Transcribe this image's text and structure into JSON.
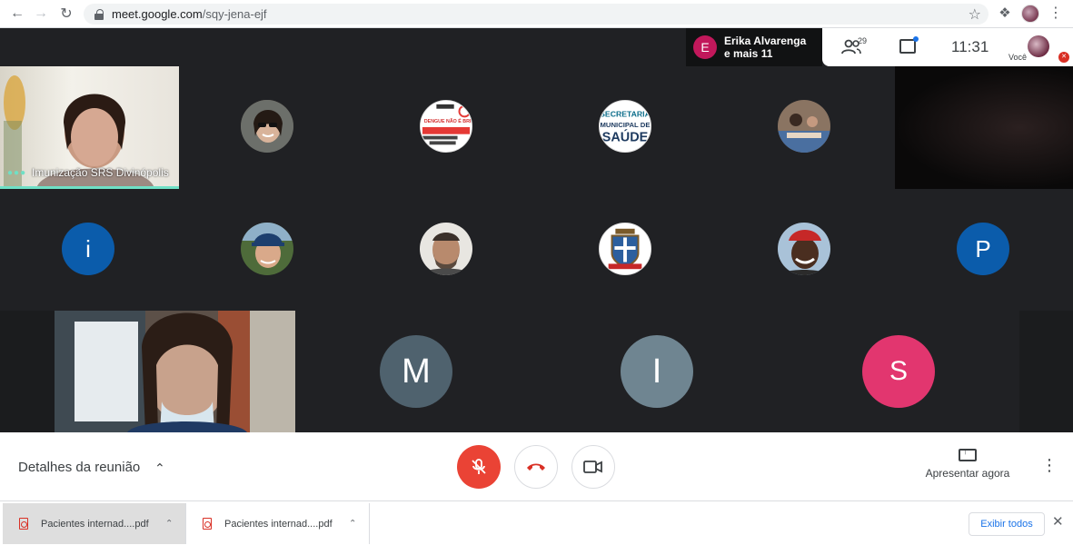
{
  "browser": {
    "url_host": "meet.google.com",
    "url_path": "/sqy-jena-ejf"
  },
  "meet_header": {
    "speaker_initial": "E",
    "speaker_line1": "Erika Alvarenga",
    "speaker_line2": "e mais 11",
    "people_count": "29",
    "clock": "11:31",
    "self_label": "Você"
  },
  "tiles": {
    "featured_label": "Imunização SRS Divinópolis",
    "row2_i_initial": "i",
    "row2_p_initial": "P",
    "row3_m_initial": "M",
    "row3_i_initial": "I",
    "row3_s_initial": "S",
    "badge_secretaria_line1": "SECRETARIA",
    "badge_secretaria_line2": "MUNICIPAL DE",
    "badge_secretaria_line3": "SAÚDE",
    "badge_dengue_text": "DENGUE NÃO É BRINCADEIRA"
  },
  "bottom_bar": {
    "details_label": "Detalhes da reunião",
    "present_label": "Apresentar agora"
  },
  "download_shelf": {
    "items": [
      {
        "name": "Pacientes internad....pdf"
      },
      {
        "name": "Pacientes internad....pdf"
      }
    ],
    "show_all": "Exibir todos"
  },
  "colors": {
    "meet_bg": "#202124",
    "mic_off_red": "#ea4335",
    "speaking_teal": "#6fe0c6",
    "avatar_blue": "#0b5cab",
    "avatar_slate": "#4f626e",
    "avatar_gray": "#6f8591",
    "avatar_pink": "#e2366f",
    "speaker_avatar": "#c2185b",
    "link_blue": "#1a73e8"
  }
}
